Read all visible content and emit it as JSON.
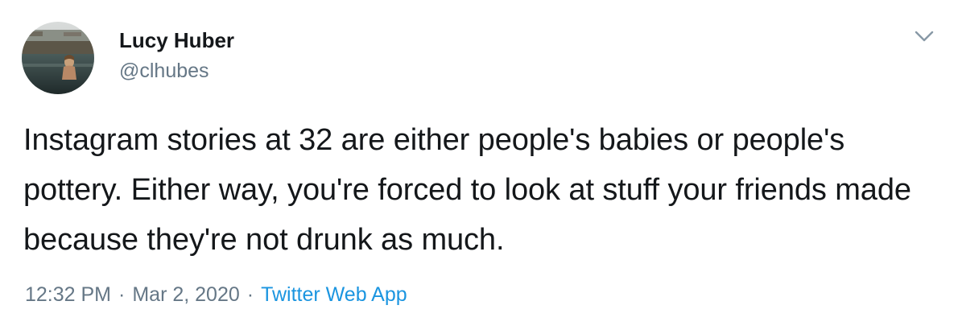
{
  "user": {
    "display_name": "Lucy Huber",
    "handle": "@clhubes"
  },
  "tweet": {
    "text": "Instagram stories at 32 are either people's babies or people's pottery. Either way, you're forced to look at stuff your friends made because they're not drunk as much.",
    "time": "12:32 PM",
    "separator": "·",
    "date": "Mar 2, 2020",
    "source": "Twitter Web App"
  },
  "icons": {
    "menu": "chevron-down-icon"
  },
  "colors": {
    "text": "#14171a",
    "secondary": "#657786",
    "link": "#1b95e0"
  }
}
